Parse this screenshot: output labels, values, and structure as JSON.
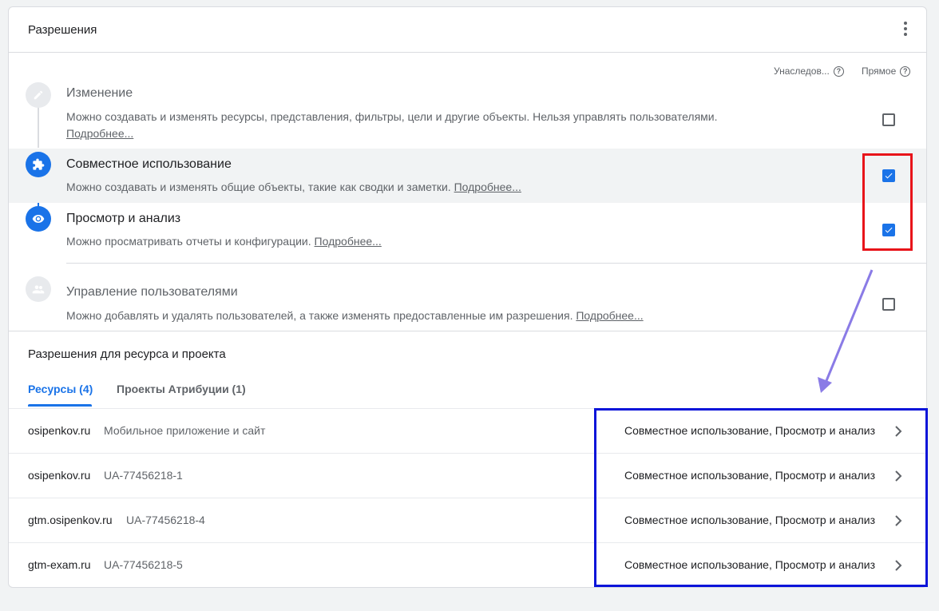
{
  "header": {
    "title": "Разрешения",
    "menu_icon": "more-vert-icon"
  },
  "columns": {
    "inherited": "Унаследов...",
    "direct": "Прямое"
  },
  "roles": [
    {
      "title": "Изменение",
      "description": "Можно создавать и изменять ресурсы, представления, фильтры, цели и другие объекты. Нельзя управлять пользователями.",
      "link": "Подробнее...",
      "icon": "pencil-icon",
      "checked": false
    },
    {
      "title": "Совместное использование",
      "description": "Можно создавать и изменять общие объекты, такие как сводки и заметки.",
      "link": "Подробнее...",
      "icon": "puzzle-icon",
      "checked": true
    },
    {
      "title": "Просмотр и анализ",
      "description": "Можно просматривать отчеты и конфигурации.",
      "link": "Подробнее...",
      "icon": "eye-icon",
      "checked": true
    },
    {
      "title": "Управление пользователями",
      "description": "Можно добавлять и удалять пользователей, а также изменять предоставленные им разрешения.",
      "link": "Подробнее...",
      "icon": "users-icon",
      "checked": false
    }
  ],
  "resource_section": {
    "title": "Разрешения для ресурса и проекта",
    "tabs": [
      {
        "label": "Ресурсы (4)",
        "active": true
      },
      {
        "label": "Проекты Атрибуции (1)",
        "active": false
      }
    ],
    "rows": [
      {
        "name": "osipenkov.ru",
        "id": "Мобильное приложение и сайт",
        "permissions": "Совместное использование, Просмотр и анализ"
      },
      {
        "name": "osipenkov.ru",
        "id": "UA-77456218-1",
        "permissions": "Совместное использование, Просмотр и анализ"
      },
      {
        "name": "gtm.osipenkov.ru",
        "id": "UA-77456218-4",
        "permissions": "Совместное использование, Просмотр и анализ"
      },
      {
        "name": "gtm-exam.ru",
        "id": "UA-77456218-5",
        "permissions": "Совместное использование, Просмотр и анализ"
      }
    ]
  },
  "colors": {
    "accent": "#1a73e8",
    "highlight_red": "#e8141a",
    "highlight_blue": "#0a14d9",
    "arrow": "#8a7be6"
  }
}
